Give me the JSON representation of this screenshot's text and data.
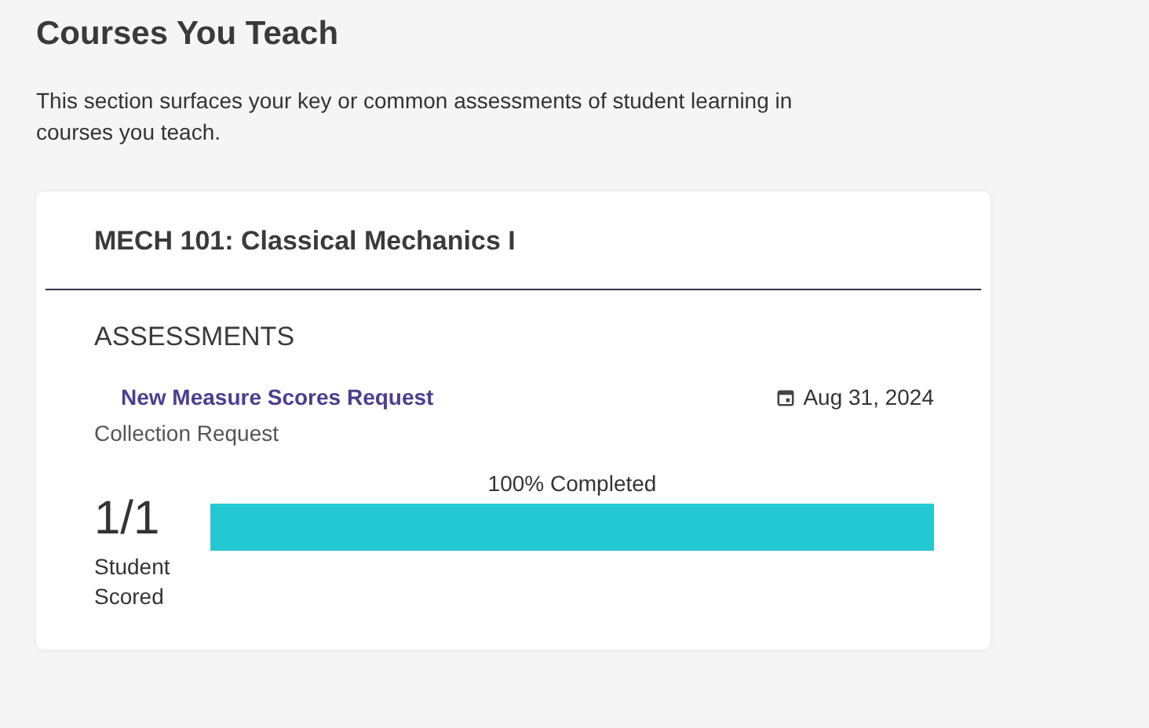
{
  "heading": "Courses You Teach",
  "description": "This section surfaces your key or common assessments of student learning in courses you teach.",
  "course": {
    "title": "MECH 101: Classical Mechanics I",
    "section_title": "ASSESSMENTS",
    "assessments": [
      {
        "name": "New Measure Scores Request",
        "date": "Aug 31, 2024",
        "type": "Collection Request",
        "progress_label": "100% Completed",
        "level": 1,
        "count": "1/1",
        "count_label": "Student Scored"
      }
    ]
  }
}
